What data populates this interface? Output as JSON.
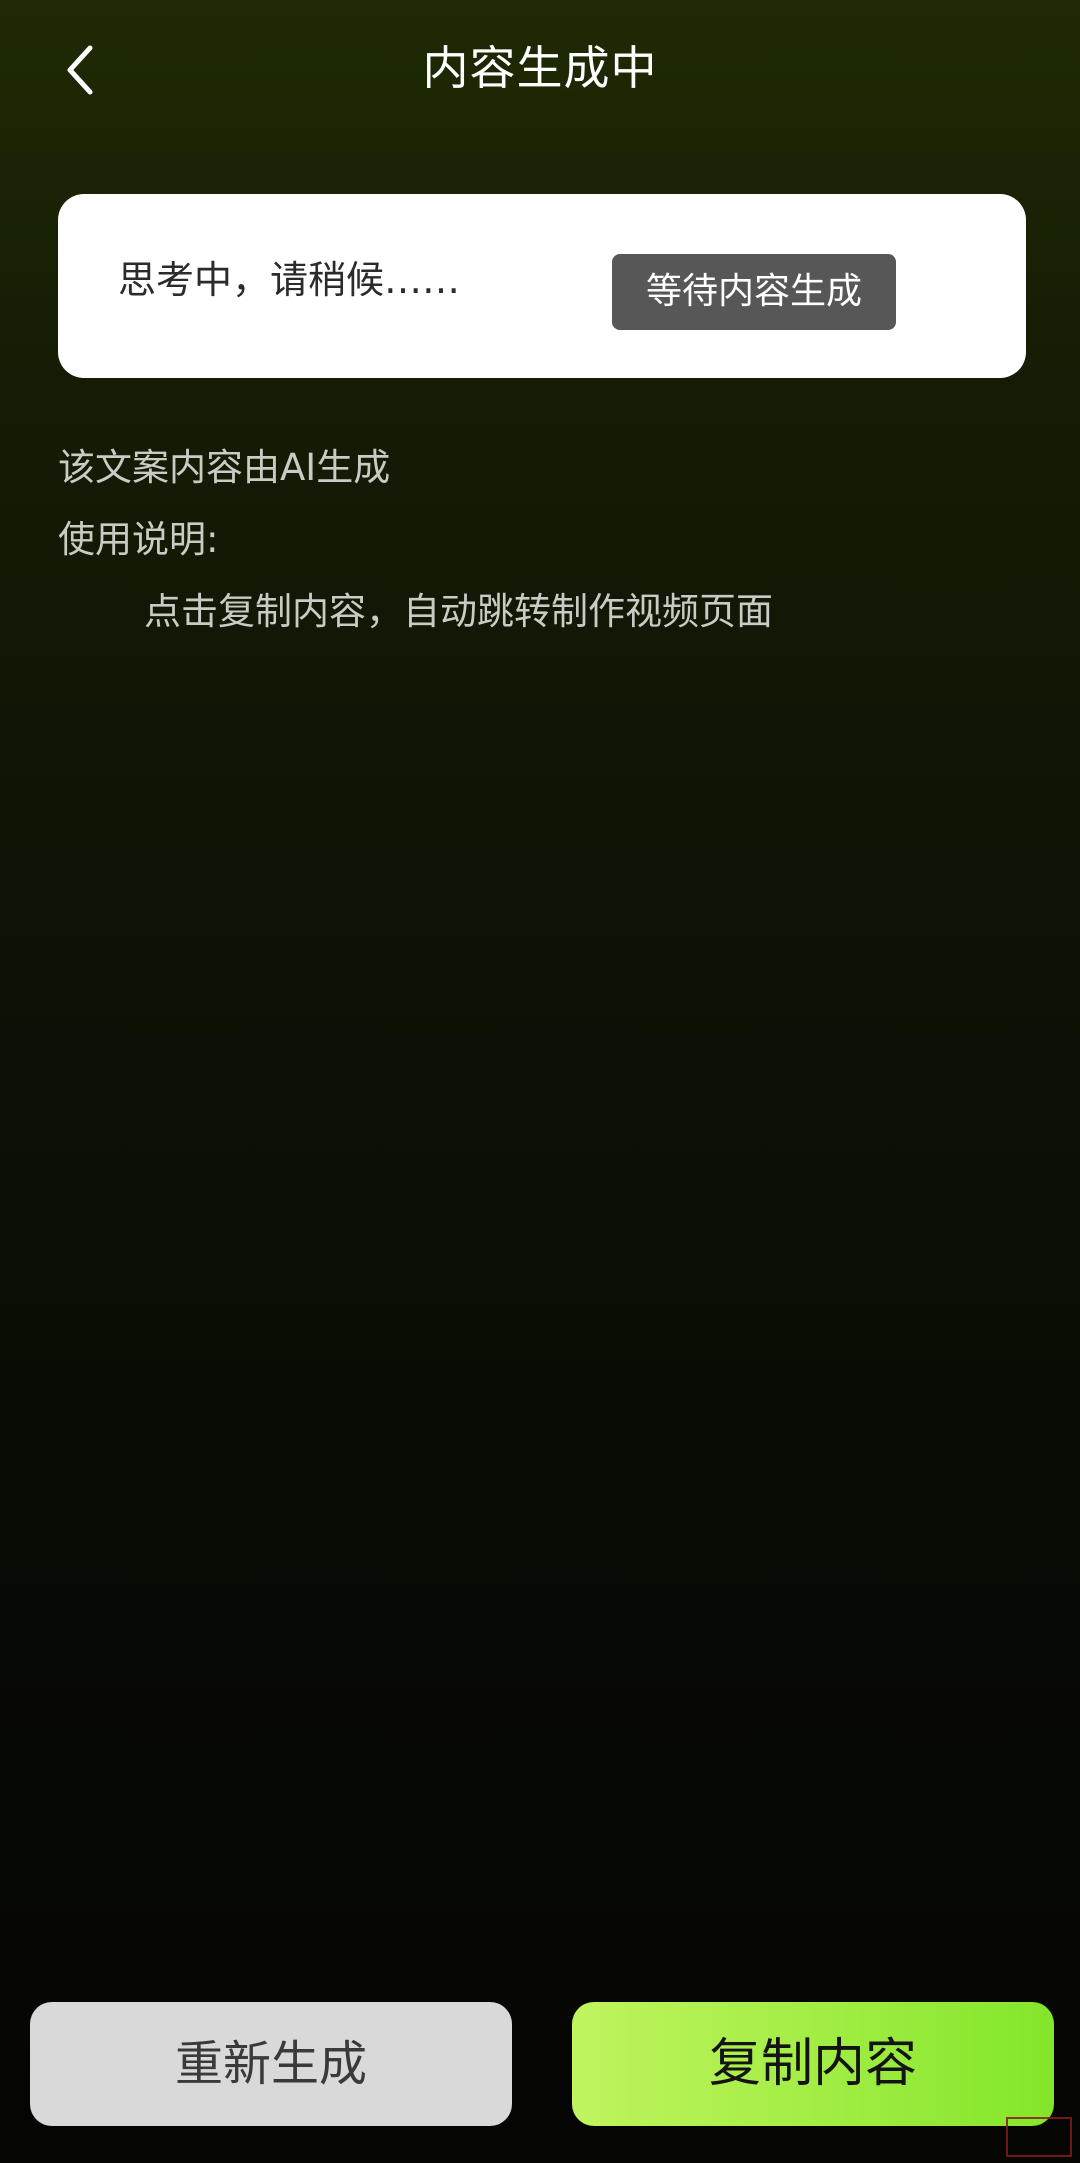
{
  "header": {
    "title": "内容生成中",
    "back_icon": "chevron-left-icon"
  },
  "status_card": {
    "status_text": "思考中，请稍候……",
    "wait_button_label": "等待内容生成"
  },
  "info": {
    "disclaimer": "该文案内容由AI生成",
    "usage_title": "使用说明:",
    "usage_detail": "点击复制内容，自动跳转制作视频页面"
  },
  "actions": {
    "regenerate_label": "重新生成",
    "copy_label": "复制内容"
  },
  "colors": {
    "background_top": "#1f2a04",
    "background_bottom": "#050603",
    "card_bg": "#ffffff",
    "wait_button_bg": "#575757",
    "regenerate_bg": "#d9d9d9",
    "copy_gradient_start": "#c0f45e",
    "copy_gradient_end": "#83e62a"
  }
}
